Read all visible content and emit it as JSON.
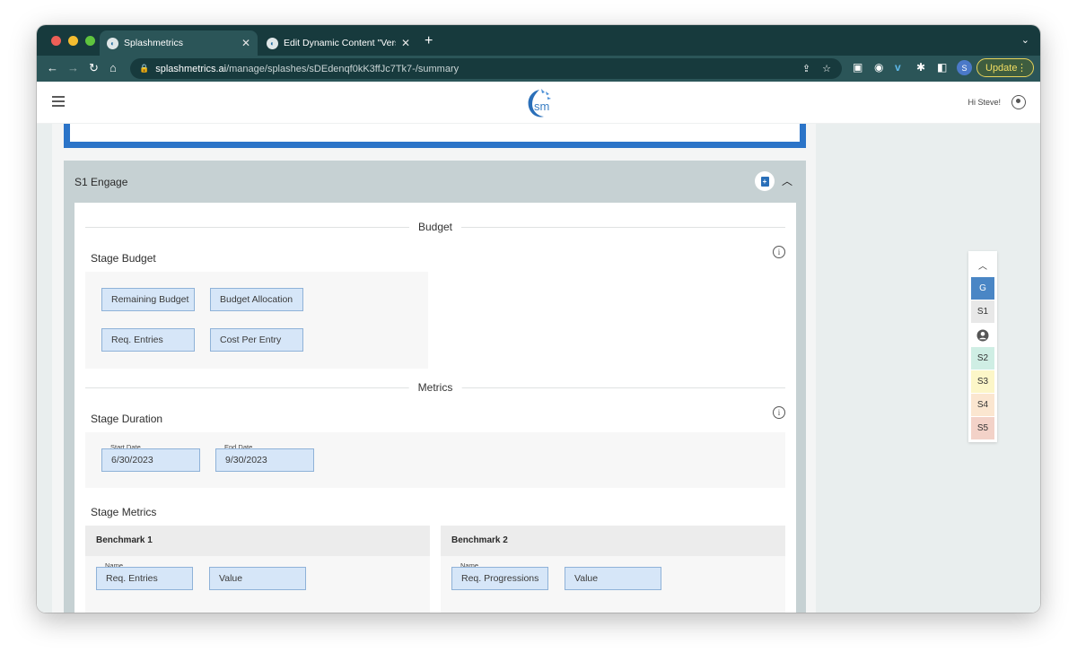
{
  "browser": {
    "tabs": [
      {
        "title": "Splashmetrics",
        "active": true
      },
      {
        "title": "Edit Dynamic Content \"Version",
        "active": false
      }
    ],
    "url_domain": "splashmetrics.ai",
    "url_path": "/manage/splashes/sDEdenqf0kK3ffJc7Tk7-/summary",
    "profile_initial": "S",
    "update_label": "Update"
  },
  "header": {
    "logo_text": "sm",
    "greeting": "Hi Steve!"
  },
  "stage": {
    "title": "S1 Engage",
    "budget_divider": "Budget",
    "stage_budget_title": "Stage Budget",
    "budget_fields": {
      "remaining_budget": "Remaining Budget",
      "budget_allocation": "Budget Allocation",
      "req_entries": "Req. Entries",
      "cost_per_entry": "Cost Per Entry"
    },
    "metrics_divider": "Metrics",
    "stage_duration_title": "Stage Duration",
    "start_date_label": "Start Date",
    "start_date": "6/30/2023",
    "end_date_label": "End Date",
    "end_date": "9/30/2023",
    "stage_metrics_title": "Stage Metrics",
    "benchmarks": [
      {
        "title": "Benchmark 1",
        "name_label": "Name",
        "name": "Req. Entries",
        "value_placeholder": "Value"
      },
      {
        "title": "Benchmark 2",
        "name_label": "Name",
        "name": "Req. Progressions",
        "value_placeholder": "Value"
      }
    ]
  },
  "rail": {
    "items": [
      "G",
      "S1",
      "S2",
      "S3",
      "S4",
      "S5"
    ],
    "colors": {
      "G": "#4a86c5",
      "S1": "#e8e8e8",
      "S2": "#cfeee4",
      "S3": "#fcf6c8",
      "S4": "#fbe6d0",
      "S5": "#f3d2c8"
    }
  },
  "colors": {
    "tab_bar": "#173a3d",
    "toolbar": "#2b5558",
    "stage_header": "#c6d1d3",
    "field_fill": "#d6e6f8",
    "accent_blue": "#2b74c8"
  }
}
